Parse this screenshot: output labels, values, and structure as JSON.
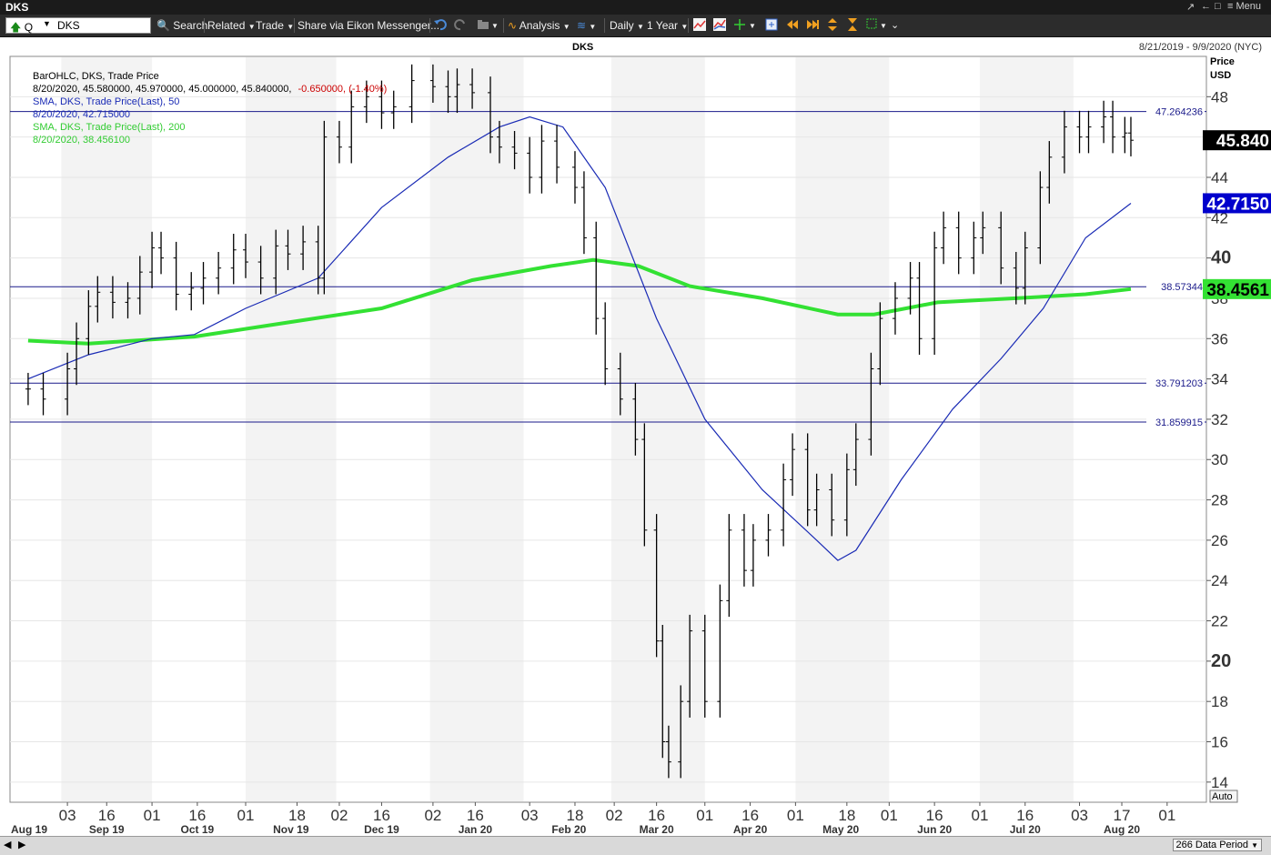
{
  "window": {
    "title": "DKS",
    "restore_label": "↗",
    "back_label": "←",
    "close_label": "□",
    "menu_label": "≡ Menu"
  },
  "toolbar": {
    "query_prefix": "Q",
    "symbol": "DKS",
    "search_label": "Search",
    "related_label": "Related",
    "trade_label": "Trade",
    "share_label": "Share via Eikon Messenger...",
    "analysis_label": "Analysis",
    "interval_label": "Daily",
    "range_label": "1 Year"
  },
  "chart": {
    "title": "DKS",
    "date_range": "8/21/2019 - 9/9/2020 (NYC)",
    "price_label": "Price",
    "currency_label": "USD",
    "auto_label": "Auto",
    "data_period": "266 Data Period"
  },
  "legend": {
    "l1": "BarOHLC, DKS, Trade Price",
    "l2_main": "8/20/2020, 45.580000, 45.970000, 45.000000, 45.840000,",
    "l2_change": "-0.650000, (-1.40%)",
    "l3": "SMA, DKS, Trade Price(Last),  50",
    "l4": "8/20/2020, 42.715000",
    "l5": "SMA, DKS, Trade Price(Last),  200",
    "l6": "8/20/2020, 38.456100"
  },
  "colors": {
    "price_bar": "#000000",
    "sma50": "#1a2bb5",
    "sma200": "#33e133",
    "hline": "#1a1a8a",
    "change_negative": "#cc0000",
    "last_price_bg": "#000000",
    "sma50_badge_bg": "#0000cc",
    "sma200_badge_bg": "#33e133"
  },
  "chart_data": {
    "type": "line",
    "title": "DKS",
    "ylabel": "Price USD",
    "ylim": [
      13,
      50
    ],
    "y_ticks": [
      14,
      16,
      18,
      20,
      22,
      24,
      26,
      28,
      30,
      32,
      34,
      36,
      38,
      40,
      42,
      44,
      46,
      48
    ],
    "x_day_labels": [
      "03",
      "16",
      "01",
      "16",
      "01",
      "18",
      "02",
      "16",
      "02",
      "16",
      "03",
      "18",
      "02",
      "16",
      "01",
      "16",
      "01",
      "18",
      "01",
      "16",
      "01",
      "16",
      "03",
      "17",
      "01"
    ],
    "x_month_labels": [
      "Aug 19",
      "Sep 19",
      "Oct 19",
      "Nov 19",
      "Dec 19",
      "Jan 20",
      "Feb 20",
      "Mar 20",
      "Apr 20",
      "May 20",
      "Jun 20",
      "Jul 20",
      "Aug 20"
    ],
    "last_values": {
      "close": "45.840",
      "sma50": "42.7150",
      "sma200": "38.4561"
    },
    "horizontal_lines": [
      {
        "value": 47.264236,
        "label": "47.264236"
      },
      {
        "value": 38.57344,
        "label": "38.57344"
      },
      {
        "value": 33.791203,
        "label": "33.791203"
      },
      {
        "value": 31.859915,
        "label": "31.859915"
      }
    ],
    "series": [
      {
        "name": "DKS",
        "kind": "ohlc_close_approx",
        "values": [
          {
            "date": "2019-08-21",
            "close": 33.5
          },
          {
            "date": "2019-08-26",
            "close": 33.0
          },
          {
            "date": "2019-09-03",
            "close": 34.5
          },
          {
            "date": "2019-09-06",
            "close": 36.0
          },
          {
            "date": "2019-09-10",
            "close": 37.6
          },
          {
            "date": "2019-09-13",
            "close": 38.3
          },
          {
            "date": "2019-09-18",
            "close": 37.8
          },
          {
            "date": "2019-09-23",
            "close": 38.0
          },
          {
            "date": "2019-09-27",
            "close": 39.3
          },
          {
            "date": "2019-10-01",
            "close": 40.5
          },
          {
            "date": "2019-10-04",
            "close": 40.0
          },
          {
            "date": "2019-10-09",
            "close": 38.2
          },
          {
            "date": "2019-10-14",
            "close": 38.5
          },
          {
            "date": "2019-10-18",
            "close": 39.0
          },
          {
            "date": "2019-10-23",
            "close": 39.5
          },
          {
            "date": "2019-10-28",
            "close": 40.4
          },
          {
            "date": "2019-11-01",
            "close": 39.8
          },
          {
            "date": "2019-11-06",
            "close": 39.0
          },
          {
            "date": "2019-11-11",
            "close": 40.6
          },
          {
            "date": "2019-11-15",
            "close": 40.2
          },
          {
            "date": "2019-11-20",
            "close": 40.8
          },
          {
            "date": "2019-11-25",
            "close": 39.0
          },
          {
            "date": "2019-11-27",
            "close": 46.0
          },
          {
            "date": "2019-12-02",
            "close": 45.5
          },
          {
            "date": "2019-12-06",
            "close": 47.5
          },
          {
            "date": "2019-12-11",
            "close": 48.0
          },
          {
            "date": "2019-12-16",
            "close": 47.2
          },
          {
            "date": "2019-12-20",
            "close": 47.5
          },
          {
            "date": "2019-12-26",
            "close": 48.8
          },
          {
            "date": "2020-01-02",
            "close": 48.5
          },
          {
            "date": "2020-01-07",
            "close": 48.0
          },
          {
            "date": "2020-01-10",
            "close": 48.6
          },
          {
            "date": "2020-01-15",
            "close": 48.2
          },
          {
            "date": "2020-01-21",
            "close": 46.0
          },
          {
            "date": "2020-01-24",
            "close": 45.5
          },
          {
            "date": "2020-01-29",
            "close": 45.2
          },
          {
            "date": "2020-02-03",
            "close": 44.0
          },
          {
            "date": "2020-02-07",
            "close": 45.8
          },
          {
            "date": "2020-02-12",
            "close": 44.5
          },
          {
            "date": "2020-02-18",
            "close": 43.5
          },
          {
            "date": "2020-02-21",
            "close": 41.0
          },
          {
            "date": "2020-02-25",
            "close": 37.0
          },
          {
            "date": "2020-02-28",
            "close": 34.5
          },
          {
            "date": "2020-03-04",
            "close": 33.0
          },
          {
            "date": "2020-03-09",
            "close": 31.0
          },
          {
            "date": "2020-03-12",
            "close": 26.5
          },
          {
            "date": "2020-03-16",
            "close": 21.0
          },
          {
            "date": "2020-03-18",
            "close": 16.0
          },
          {
            "date": "2020-03-20",
            "close": 15.0
          },
          {
            "date": "2020-03-24",
            "close": 18.0
          },
          {
            "date": "2020-03-27",
            "close": 21.5
          },
          {
            "date": "2020-04-01",
            "close": 18.0
          },
          {
            "date": "2020-04-06",
            "close": 23.0
          },
          {
            "date": "2020-04-09",
            "close": 26.5
          },
          {
            "date": "2020-04-14",
            "close": 24.5
          },
          {
            "date": "2020-04-17",
            "close": 26.0
          },
          {
            "date": "2020-04-22",
            "close": 26.5
          },
          {
            "date": "2020-04-27",
            "close": 29.0
          },
          {
            "date": "2020-04-30",
            "close": 30.5
          },
          {
            "date": "2020-05-05",
            "close": 27.5
          },
          {
            "date": "2020-05-08",
            "close": 28.5
          },
          {
            "date": "2020-05-13",
            "close": 27.0
          },
          {
            "date": "2020-05-18",
            "close": 29.5
          },
          {
            "date": "2020-05-21",
            "close": 31.0
          },
          {
            "date": "2020-05-26",
            "close": 34.5
          },
          {
            "date": "2020-05-29",
            "close": 37.0
          },
          {
            "date": "2020-06-03",
            "close": 38.0
          },
          {
            "date": "2020-06-08",
            "close": 39.0
          },
          {
            "date": "2020-06-11",
            "close": 36.0
          },
          {
            "date": "2020-06-16",
            "close": 40.5
          },
          {
            "date": "2020-06-19",
            "close": 41.5
          },
          {
            "date": "2020-06-24",
            "close": 40.0
          },
          {
            "date": "2020-06-29",
            "close": 41.0
          },
          {
            "date": "2020-07-02",
            "close": 41.5
          },
          {
            "date": "2020-07-08",
            "close": 39.5
          },
          {
            "date": "2020-07-13",
            "close": 38.5
          },
          {
            "date": "2020-07-16",
            "close": 40.5
          },
          {
            "date": "2020-07-21",
            "close": 43.5
          },
          {
            "date": "2020-07-24",
            "close": 45.0
          },
          {
            "date": "2020-07-29",
            "close": 46.5
          },
          {
            "date": "2020-08-03",
            "close": 46.0
          },
          {
            "date": "2020-08-06",
            "close": 46.5
          },
          {
            "date": "2020-08-11",
            "close": 47.0
          },
          {
            "date": "2020-08-14",
            "close": 46.0
          },
          {
            "date": "2020-08-18",
            "close": 46.2
          },
          {
            "date": "2020-08-20",
            "close": 45.84
          }
        ]
      },
      {
        "name": "SMA, DKS, Trade Price(Last), 50",
        "values": [
          {
            "date": "2019-08-21",
            "value": 34.0
          },
          {
            "date": "2019-09-10",
            "value": 35.2
          },
          {
            "date": "2019-10-01",
            "value": 36.0
          },
          {
            "date": "2019-10-15",
            "value": 36.2
          },
          {
            "date": "2019-11-01",
            "value": 37.5
          },
          {
            "date": "2019-11-25",
            "value": 39.0
          },
          {
            "date": "2019-12-16",
            "value": 42.5
          },
          {
            "date": "2020-01-07",
            "value": 45.0
          },
          {
            "date": "2020-01-24",
            "value": 46.5
          },
          {
            "date": "2020-02-03",
            "value": 47.0
          },
          {
            "date": "2020-02-14",
            "value": 46.5
          },
          {
            "date": "2020-02-28",
            "value": 43.5
          },
          {
            "date": "2020-03-16",
            "value": 37.0
          },
          {
            "date": "2020-04-01",
            "value": 32.0
          },
          {
            "date": "2020-04-20",
            "value": 28.5
          },
          {
            "date": "2020-05-08",
            "value": 26.0
          },
          {
            "date": "2020-05-15",
            "value": 25.0
          },
          {
            "date": "2020-05-21",
            "value": 25.5
          },
          {
            "date": "2020-06-05",
            "value": 29.0
          },
          {
            "date": "2020-06-22",
            "value": 32.5
          },
          {
            "date": "2020-07-08",
            "value": 35.0
          },
          {
            "date": "2020-07-22",
            "value": 37.5
          },
          {
            "date": "2020-08-05",
            "value": 41.0
          },
          {
            "date": "2020-08-20",
            "value": 42.715
          }
        ]
      },
      {
        "name": "SMA, DKS, Trade Price(Last), 200",
        "values": [
          {
            "date": "2019-08-21",
            "value": 35.9
          },
          {
            "date": "2019-09-10",
            "value": 35.75
          },
          {
            "date": "2019-10-15",
            "value": 36.1
          },
          {
            "date": "2019-11-15",
            "value": 36.8
          },
          {
            "date": "2019-12-16",
            "value": 37.5
          },
          {
            "date": "2020-01-15",
            "value": 38.9
          },
          {
            "date": "2020-02-10",
            "value": 39.6
          },
          {
            "date": "2020-02-24",
            "value": 39.9
          },
          {
            "date": "2020-03-10",
            "value": 39.6
          },
          {
            "date": "2020-03-27",
            "value": 38.6
          },
          {
            "date": "2020-04-20",
            "value": 38.0
          },
          {
            "date": "2020-05-15",
            "value": 37.2
          },
          {
            "date": "2020-05-27",
            "value": 37.2
          },
          {
            "date": "2020-06-17",
            "value": 37.8
          },
          {
            "date": "2020-07-13",
            "value": 38.0
          },
          {
            "date": "2020-08-05",
            "value": 38.2
          },
          {
            "date": "2020-08-20",
            "value": 38.456
          }
        ]
      }
    ]
  }
}
